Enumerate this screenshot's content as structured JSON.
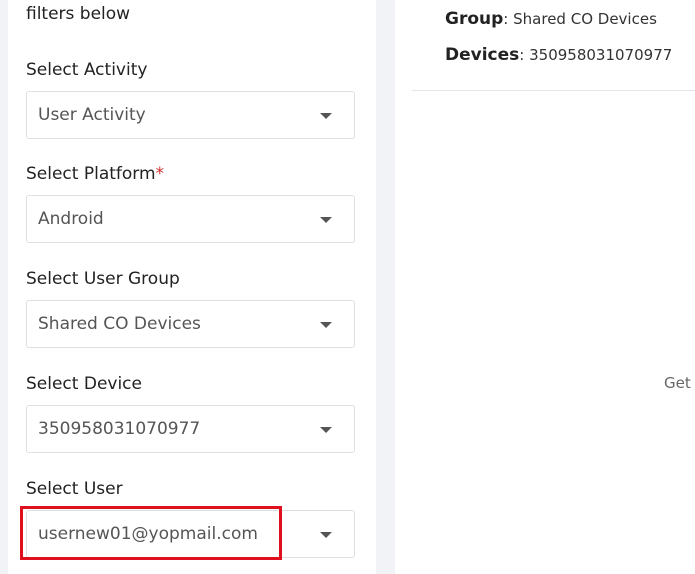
{
  "filters": {
    "intro": "filters below",
    "activity": {
      "label": "Select Activity",
      "value": "User Activity"
    },
    "platform": {
      "label": "Select Platform",
      "required_mark": "*",
      "value": "Android"
    },
    "user_group": {
      "label": "Select User Group",
      "value": "Shared CO Devices"
    },
    "device": {
      "label": "Select Device",
      "value": "350958031070977"
    },
    "user": {
      "label": "Select User",
      "value": "usernew01@yopmail.com"
    }
  },
  "details": {
    "group_key": "Group",
    "group_sep": ":",
    "group_value": "Shared CO Devices",
    "devices_key": "Devices",
    "devices_sep": ":",
    "devices_value": "350958031070977",
    "truncated_text": "Get i"
  },
  "colors": {
    "highlight": "#e0101f",
    "required": "#d32f2f",
    "background": "#f1f3f6"
  },
  "icons": {
    "dropdown": "chevron-down-icon"
  }
}
